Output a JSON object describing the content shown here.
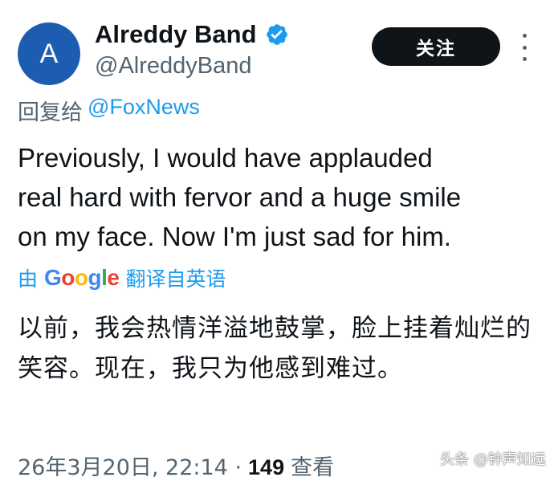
{
  "author": {
    "avatar_letter": "A",
    "display_name": "Alreddy Band",
    "handle": "@AlreddyBand",
    "verified_icon": "verified-badge-icon",
    "avatar_color": "#1d5db1"
  },
  "actions": {
    "follow_label": "关注",
    "more_icon": "more-vertical-icon"
  },
  "reply": {
    "prefix": "回复给",
    "target_handle": "@FoxNews"
  },
  "tweet": {
    "text": "Previously, I would have applauded\nreal hard with fervor and a huge smile\non my face. Now I'm just sad for him."
  },
  "translation": {
    "prefix": "由",
    "provider": "Google",
    "suffix": "翻译自英语",
    "text": "以前，我会热情洋溢地鼓掌，脸上挂着灿烂的笑容。现在，我只为他感到难过。"
  },
  "meta": {
    "timestamp": "26年3月20日, 22:14 ·",
    "views_count": "149",
    "views_label": "查看"
  },
  "watermark": {
    "text": "头条 @钟声知远"
  },
  "colors": {
    "link": "#1d9bf0",
    "secondary_text": "#536471",
    "primary_text": "#0f1419",
    "button_bg": "#0f1419"
  }
}
